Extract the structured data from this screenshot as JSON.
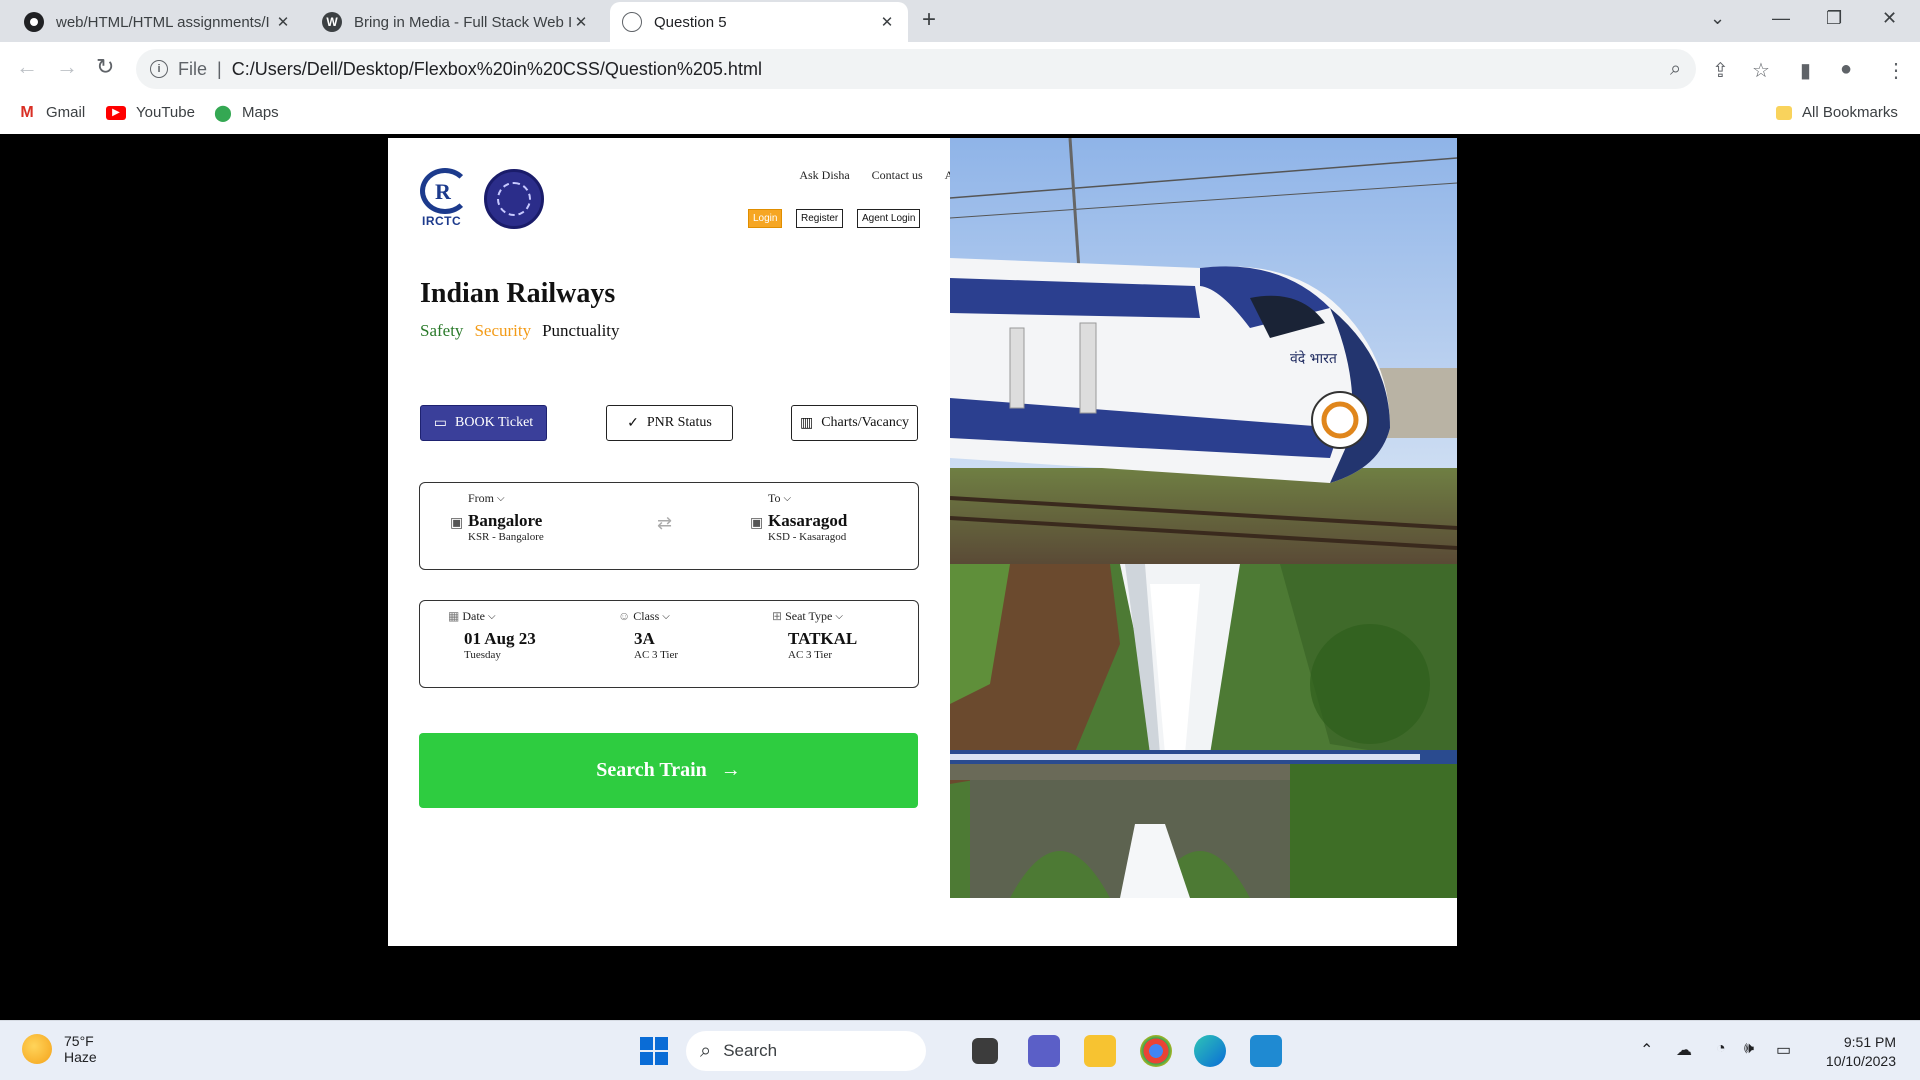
{
  "browser": {
    "tabs": [
      {
        "title": "web/HTML/HTML assignments/I",
        "active": false,
        "icon": "github-icon"
      },
      {
        "title": "Bring in Media - Full Stack Web I",
        "active": false,
        "icon": "wordpress-icon"
      },
      {
        "title": "Question 5",
        "active": true,
        "icon": "globe-icon"
      }
    ],
    "address": {
      "scheme": "File",
      "url": "C:/Users/Dell/Desktop/Flexbox%20in%20CSS/Question%205.html"
    },
    "bookmarks": [
      {
        "label": "Gmail",
        "icon": "gmail-icon"
      },
      {
        "label": "YouTube",
        "icon": "youtube-icon"
      },
      {
        "label": "Maps",
        "icon": "maps-icon"
      }
    ],
    "all_bookmarks": "All Bookmarks"
  },
  "page": {
    "logo_text": "IRCTC",
    "top_links": [
      "Ask Disha",
      "Contact us",
      "Alerts"
    ],
    "auth_buttons": [
      "Login",
      "Register",
      "Agent Login"
    ],
    "title": "Indian Railways",
    "tagline": [
      "Safety",
      "Security",
      "Punctuality"
    ],
    "modes": [
      {
        "label": "BOOK Ticket",
        "icon": "ticket-icon",
        "active": true
      },
      {
        "label": "PNR Status",
        "icon": "check-icon",
        "active": false
      },
      {
        "label": "Charts/Vacancy",
        "icon": "chart-icon",
        "active": false
      }
    ],
    "from": {
      "label": "From",
      "value": "Bangalore",
      "sub": "KSR - Bangalore"
    },
    "to": {
      "label": "To",
      "value": "Kasaragod",
      "sub": "KSD - Kasaragod"
    },
    "date": {
      "label": "Date",
      "value": "01 Aug 23",
      "sub": "Tuesday"
    },
    "class": {
      "label": "Class",
      "value": "3A",
      "sub": "AC 3 Tier"
    },
    "seat": {
      "label": "Seat Type",
      "value": "TATKAL",
      "sub": "AC 3 Tier"
    },
    "search_button": "Search Train",
    "train_livery": "वंदे भारत"
  },
  "taskbar": {
    "temperature": "75°F",
    "condition": "Haze",
    "search_placeholder": "Search",
    "time": "9:51 PM",
    "date": "10/10/2023"
  },
  "colors": {
    "accent_book": "#3a3f9a",
    "search_green": "#2ecc40",
    "login_orange": "#f6a623"
  }
}
